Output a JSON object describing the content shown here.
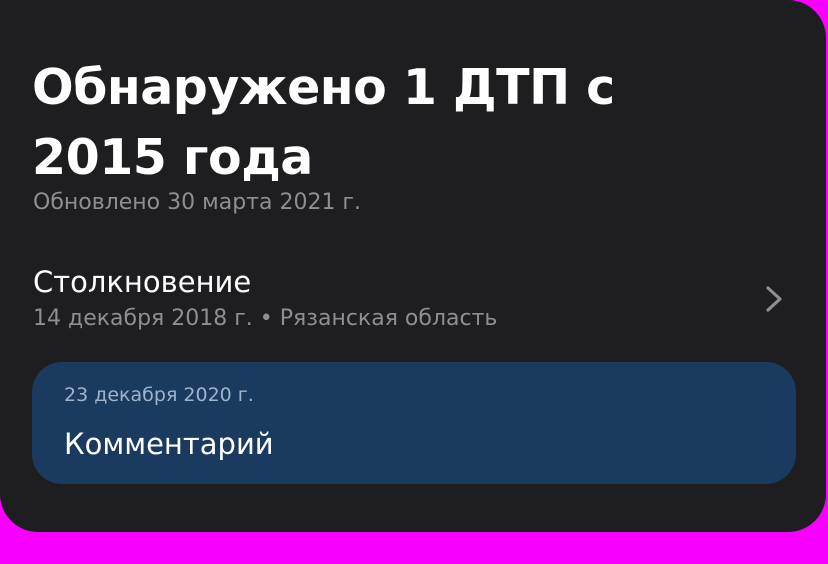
{
  "report": {
    "title": "Обнаружено 1 ДТП с 2015 года",
    "updated": "Обновлено 30 марта 2021 г."
  },
  "accident": {
    "type": "Столкновение",
    "date_region": "14 декабря 2018 г. • Рязанская область",
    "chevron_icon": "chevron-right-icon"
  },
  "comment": {
    "date": "23 декабря 2020 г.",
    "label": "Комментарий"
  },
  "colors": {
    "card_background": "#1e1e20",
    "page_background": "#f700ff",
    "comment_background": "#1a3a5f",
    "primary_text": "#ffffff",
    "secondary_text": "#8e8e93"
  }
}
